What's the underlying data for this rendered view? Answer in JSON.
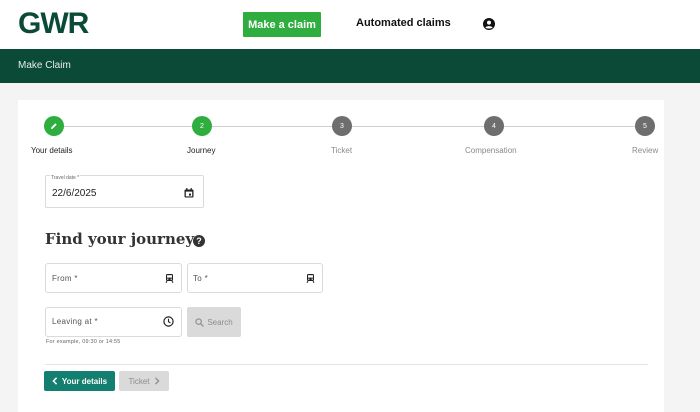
{
  "header": {
    "logo": "GWR",
    "make_claim_label": "Make a claim",
    "automated_claims_label": "Automated claims",
    "account_icon": "user-circle-icon"
  },
  "banner": {
    "title": "Make Claim"
  },
  "stepper": {
    "steps": [
      {
        "number": "1",
        "label": "Your details",
        "state": "done",
        "icon": "pencil-icon"
      },
      {
        "number": "2",
        "label": "Journey",
        "state": "active"
      },
      {
        "number": "3",
        "label": "Ticket",
        "state": "todo"
      },
      {
        "number": "4",
        "label": "Compensation",
        "state": "todo"
      },
      {
        "number": "5",
        "label": "Review",
        "state": "todo"
      }
    ]
  },
  "form": {
    "travel_date": {
      "label": "Travel date *",
      "value": "22/6/2025",
      "icon": "calendar-icon"
    },
    "heading": "Find your journey",
    "help_icon": "question-circle-icon",
    "from": {
      "placeholder": "From *",
      "icon": "train-icon"
    },
    "to": {
      "placeholder": "To *",
      "icon": "train-icon"
    },
    "leaving_at": {
      "placeholder": "Leaving at *",
      "icon": "clock-icon"
    },
    "search_label": "Search",
    "hint": "For example, 09:30 or 14:55"
  },
  "footer_nav": {
    "back_label": "Your details",
    "next_label": "Ticket"
  },
  "colors": {
    "brand_green": "#0b4a36",
    "accent_green": "#2fae3f",
    "teal_button": "#127f70",
    "step_inactive": "#6e6e6e"
  }
}
